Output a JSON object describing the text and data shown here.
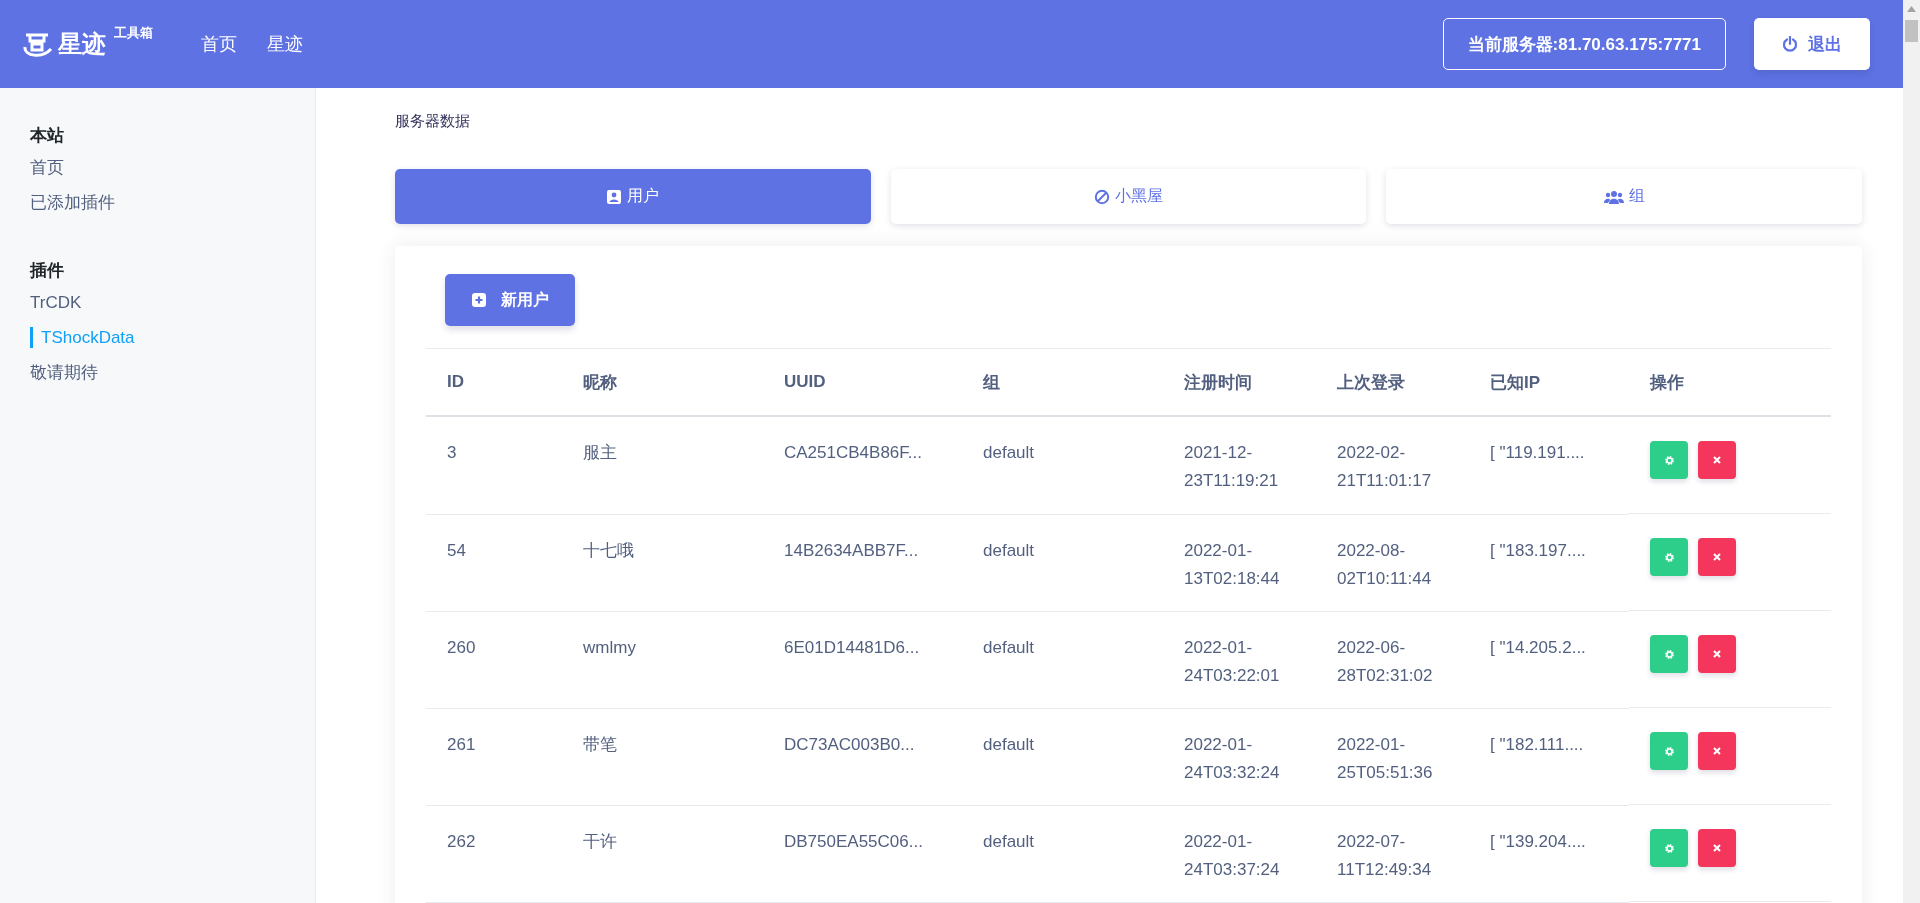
{
  "header": {
    "logo": {
      "name": "星迹",
      "suffix": "工具箱"
    },
    "nav": [
      {
        "label": "首页"
      },
      {
        "label": "星迹"
      }
    ],
    "server": "当前服务器:81.70.63.175:7771",
    "logout": "退出"
  },
  "sidebar": {
    "sections": [
      {
        "title": "本站",
        "items": [
          {
            "label": "首页",
            "selected": false
          },
          {
            "label": "已添加插件",
            "selected": false
          }
        ]
      },
      {
        "title": "插件",
        "items": [
          {
            "label": "TrCDK",
            "selected": false
          },
          {
            "label": "TShockData",
            "selected": true
          },
          {
            "label": "敬请期待",
            "selected": false
          }
        ]
      }
    ]
  },
  "breadcrumb": "服务器数据",
  "tabs": [
    {
      "label": "用户",
      "kind": "user",
      "selected": true
    },
    {
      "label": "小黑屋",
      "kind": "ban",
      "selected": false
    },
    {
      "label": "组",
      "kind": "group",
      "selected": false
    }
  ],
  "new_button": "新用户",
  "table": {
    "columns": [
      "ID",
      "昵称",
      "UUID",
      "组",
      "注册时间",
      "上次登录",
      "已知IP",
      "操作"
    ],
    "rows": [
      {
        "id": "3",
        "name": "服主",
        "uuid": "CA251CB4B86F...",
        "group": "default",
        "registered": "2021-12-23T11:19:21",
        "last_login": "2022-02-21T11:01:17",
        "known_ip": "[ \"119.191...."
      },
      {
        "id": "54",
        "name": "十七哦",
        "uuid": "14B2634ABB7F...",
        "group": "default",
        "registered": "2022-01-13T02:18:44",
        "last_login": "2022-08-02T10:11:44",
        "known_ip": "[ \"183.197...."
      },
      {
        "id": "260",
        "name": "wmlmy",
        "uuid": "6E01D14481D6...",
        "group": "default",
        "registered": "2022-01-24T03:22:01",
        "last_login": "2022-06-28T02:31:02",
        "known_ip": "[ \"14.205.2..."
      },
      {
        "id": "261",
        "name": "带笔",
        "uuid": "DC73AC003B0...",
        "group": "default",
        "registered": "2022-01-24T03:32:24",
        "last_login": "2022-01-25T05:51:36",
        "known_ip": "[ \"182.111...."
      },
      {
        "id": "262",
        "name": "干许",
        "uuid": "DB750EA55C06...",
        "group": "default",
        "registered": "2022-01-24T03:37:24",
        "last_login": "2022-07-11T12:49:34",
        "known_ip": "[ \"139.204...."
      }
    ]
  }
}
